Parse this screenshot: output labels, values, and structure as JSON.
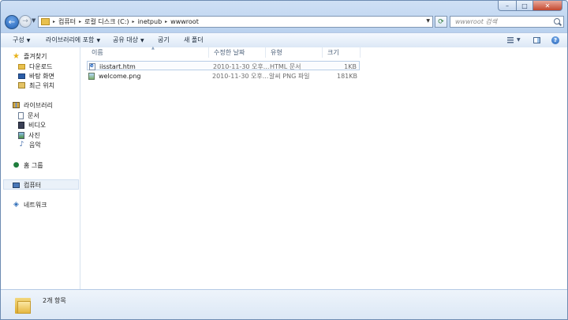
{
  "window": {
    "title": "",
    "controls": {
      "minimize": "–",
      "maximize": "□",
      "close": "✕"
    }
  },
  "address": {
    "crumbs": [
      "컴퓨터",
      "로컬 디스크 (C:)",
      "inetpub",
      "wwwroot"
    ],
    "separator": "▸"
  },
  "search": {
    "placeholder": "wwwroot 검색"
  },
  "toolbar": {
    "organize": "구성",
    "include_library": "라이브러리에 포함",
    "share_with": "공유 대상",
    "burn": "굽기",
    "new_folder": "새 폴더"
  },
  "sidebar": {
    "favorites": "즐겨찾기",
    "favorites_items": [
      "다운로드",
      "바탕 화면",
      "최근 위치"
    ],
    "libraries": "라이브러리",
    "libraries_items": [
      "문서",
      "비디오",
      "사진",
      "음악"
    ],
    "homegroup": "홈 그룹",
    "computer": "컴퓨터",
    "network": "네트워크"
  },
  "columns": {
    "name": "이름",
    "date": "수정한 날짜",
    "type": "유형",
    "size": "크기"
  },
  "files": [
    {
      "name": "iisstart.htm",
      "date": "2010-11-30 오후...",
      "type": "HTML 문서",
      "size": "1KB",
      "icon": "ie-file-icon"
    },
    {
      "name": "welcome.png",
      "date": "2010-11-30 오후...",
      "type": "알씨 PNG 파일",
      "size": "181KB",
      "icon": "png-file-icon"
    }
  ],
  "status": {
    "count": "2개 항목"
  }
}
